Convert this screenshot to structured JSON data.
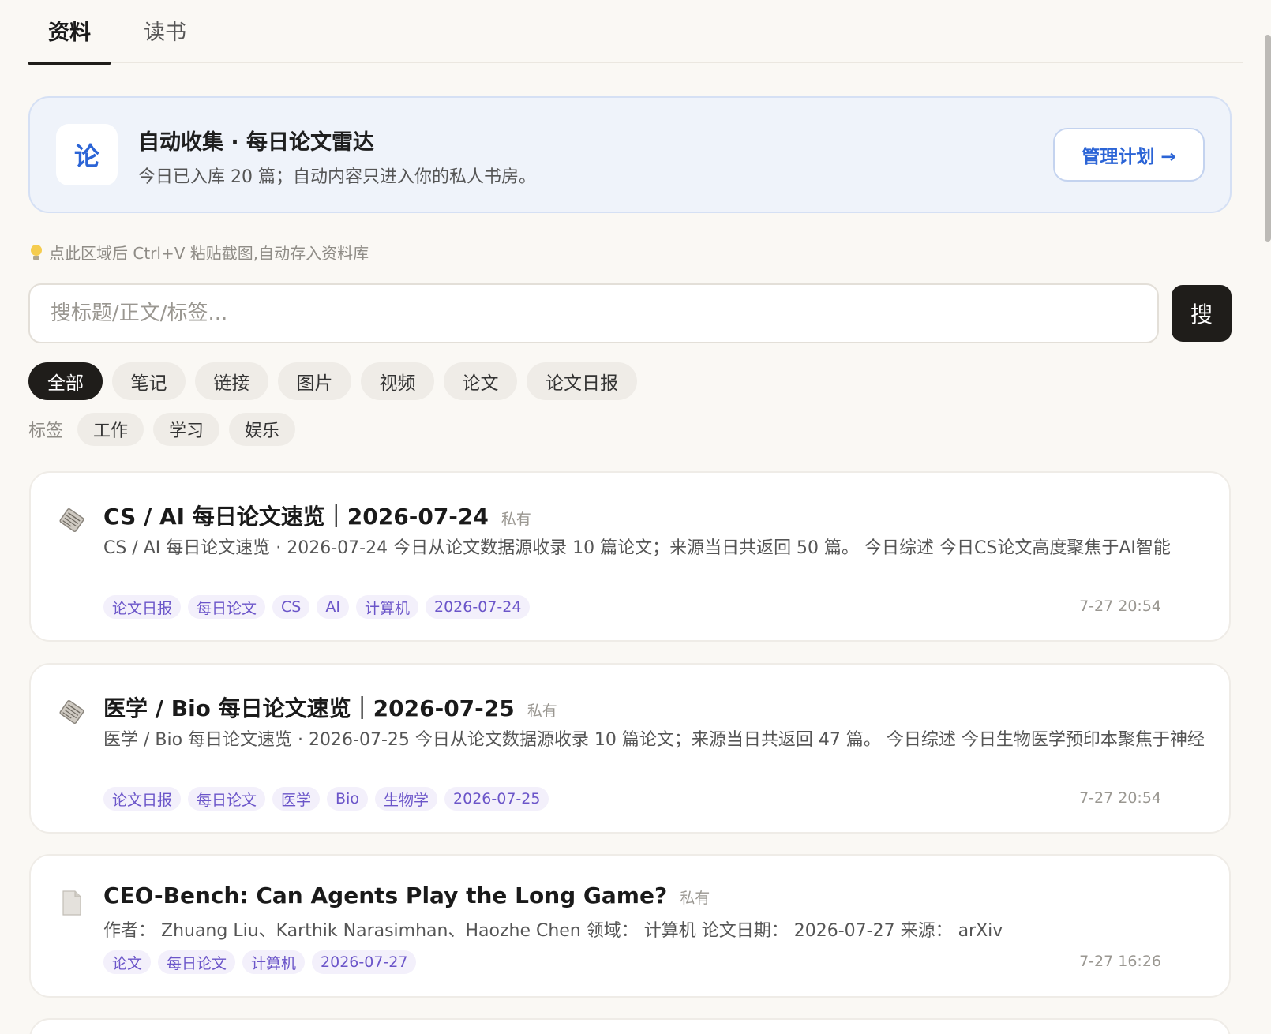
{
  "tabs": [
    {
      "label": "资料",
      "active": true
    },
    {
      "label": "读书",
      "active": false
    }
  ],
  "banner": {
    "icon_text": "论",
    "title": "自动收集 · 每日论文雷达",
    "subtitle": "今日已入库 20 篇；自动内容只进入你的私人书房。",
    "button": "管理计划 →"
  },
  "hint": {
    "icon": "lightbulb-icon",
    "text": "点此区域后 Ctrl+V 粘贴截图,自动存入资料库"
  },
  "search": {
    "placeholder": "搜标题/正文/标签...",
    "value": "",
    "button": "搜"
  },
  "filters": [
    "全部",
    "笔记",
    "链接",
    "图片",
    "视频",
    "论文",
    "论文日报"
  ],
  "active_filter": "全部",
  "tags": {
    "label": "标签",
    "items": [
      "工作",
      "学习",
      "娱乐"
    ]
  },
  "cards": [
    {
      "icon": "newspaper-icon",
      "title": "CS / AI 每日论文速览｜2026-07-24",
      "privacy": "私有",
      "desc": "CS / AI 每日论文速览 · 2026-07-24 今日从论文数据源收录 10 篇论文；来源当日共返回 50 篇。 今日综述 今日CS论文高度聚焦于AI智能",
      "tags": [
        "论文日报",
        "每日论文",
        "CS",
        "AI",
        "计算机",
        "2026-07-24"
      ],
      "time": "7-27 20:54"
    },
    {
      "icon": "newspaper-icon",
      "title": "医学 / Bio 每日论文速览｜2026-07-25",
      "privacy": "私有",
      "desc": "医学 / Bio 每日论文速览 · 2026-07-25 今日从论文数据源收录 10 篇论文；来源当日共返回 47 篇。 今日综述 今日生物医学预印本聚焦于神经",
      "tags": [
        "论文日报",
        "每日论文",
        "医学",
        "Bio",
        "生物学",
        "2026-07-25"
      ],
      "time": "7-27 20:54"
    },
    {
      "icon": "document-icon",
      "title": "CEO-Bench: Can Agents Play the Long Game?",
      "privacy": "私有",
      "desc": "作者： Zhuang Liu、Karthik Narasimhan、Haozhe Chen 领域： 计算机 论文日期： 2026-07-27 来源： arXiv",
      "tags": [
        "论文",
        "每日论文",
        "计算机",
        "2026-07-27"
      ],
      "time": "7-27 16:26"
    }
  ],
  "colors": {
    "background": "#faf8f4",
    "accent_blue": "#2b64d6",
    "tag_purple": "#6b55c9",
    "dark": "#1f1d1a"
  }
}
